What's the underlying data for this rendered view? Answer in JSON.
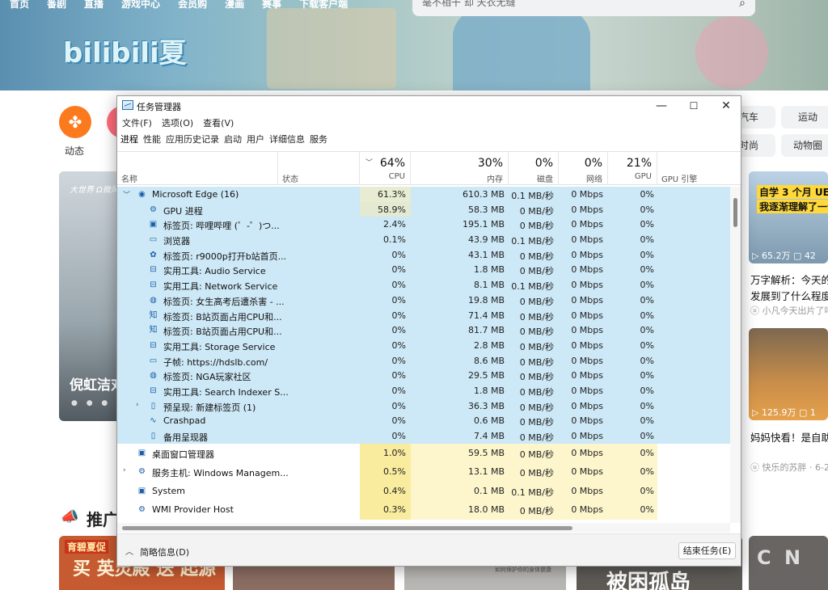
{
  "page": {
    "nav": [
      "首页",
      "番剧",
      "直播",
      "游戏中心",
      "会员购",
      "漫画",
      "赛事",
      "下载客户端"
    ],
    "search_placeholder": "毫不相干 却 天衣无缝",
    "logo_text": "bilibili夏",
    "channel_dongtai": "动态",
    "right_tags": [
      "汽车",
      "运动",
      "时尚",
      "动物圈"
    ],
    "hero_label": "倪虹洁对",
    "hero_mark": "大世界 Ω微风机",
    "hero_dots": "● ● ● ●",
    "video1": {
      "banner1": "自学 3 个月 UE5",
      "banner2": "我逐渐理解了一个",
      "views": "65.2万",
      "extra": "42",
      "title1": "万字解析：今天的",
      "title2": "发展到了什么程度",
      "up": "小凡今天出片了吗"
    },
    "video2": {
      "views": "125.9万",
      "extra": "1",
      "title": "妈妈快看！是自助",
      "up": "快乐的苏胖 · 6-2"
    },
    "recommend_label": "推广",
    "rec1_badge": "育碧夏促",
    "rec1_big": "买 英灵殿 送 起源",
    "rec3_caption": "如何保护你的身体健康",
    "rec4_big": "被困孤岛",
    "rec5_big": "C N"
  },
  "taskmgr": {
    "title": "任务管理器",
    "menu": [
      "文件(F)",
      "选项(O)",
      "查看(V)"
    ],
    "tabs": [
      "进程",
      "性能",
      "应用历史记录",
      "启动",
      "用户",
      "详细信息",
      "服务"
    ],
    "header": {
      "name": "名称",
      "status": "状态",
      "gpu_engine": "GPU 引擎",
      "cpu": {
        "pct": "64%",
        "label": "CPU"
      },
      "mem": {
        "pct": "30%",
        "label": "内存"
      },
      "disk": {
        "pct": "0%",
        "label": "磁盘"
      },
      "net": {
        "pct": "0%",
        "label": "网络"
      },
      "gpu": {
        "pct": "21%",
        "label": "GPU"
      }
    },
    "rows": [
      {
        "exp": "﹀",
        "icon": "edge-icon",
        "glyph": "◉",
        "indent": 0,
        "name": "Microsoft Edge (16)",
        "cpu": "61.3%",
        "mem": "610.3 MB",
        "disk": "0.1 MB/秒",
        "net": "0 Mbps",
        "gpu": "0%",
        "sel": true
      },
      {
        "exp": "",
        "icon": "gpu-process-icon",
        "glyph": "⚙",
        "indent": 1,
        "name": "GPU 进程",
        "cpu": "58.9%",
        "mem": "58.3 MB",
        "disk": "0 MB/秒",
        "net": "0 Mbps",
        "gpu": "0%",
        "sel": true
      },
      {
        "exp": "",
        "icon": "bilibili-tab-icon",
        "glyph": "▣",
        "indent": 1,
        "name": "标签页: 哔哩哔哩 (゜-゜)つ...",
        "cpu": "2.4%",
        "mem": "195.1 MB",
        "disk": "0 MB/秒",
        "net": "0 Mbps",
        "gpu": "0%",
        "sel": true
      },
      {
        "exp": "",
        "icon": "browser-icon",
        "glyph": "▭",
        "indent": 1,
        "name": "浏览器",
        "cpu": "0.1%",
        "mem": "43.9 MB",
        "disk": "0.1 MB/秒",
        "net": "0 Mbps",
        "gpu": "0%",
        "sel": true
      },
      {
        "exp": "",
        "icon": "baidu-tab-icon",
        "glyph": "✿",
        "indent": 1,
        "name": "标签页: r9000p打开b站首页...",
        "cpu": "0%",
        "mem": "43.1 MB",
        "disk": "0 MB/秒",
        "net": "0 Mbps",
        "gpu": "0%",
        "sel": true
      },
      {
        "exp": "",
        "icon": "utility-icon",
        "glyph": "⊟",
        "indent": 1,
        "name": "实用工具: Audio Service",
        "cpu": "0%",
        "mem": "1.8 MB",
        "disk": "0 MB/秒",
        "net": "0 Mbps",
        "gpu": "0%",
        "sel": true
      },
      {
        "exp": "",
        "icon": "utility-icon",
        "glyph": "⊟",
        "indent": 1,
        "name": "实用工具: Network Service",
        "cpu": "0%",
        "mem": "8.1 MB",
        "disk": "0.1 MB/秒",
        "net": "0 Mbps",
        "gpu": "0%",
        "sel": true
      },
      {
        "exp": "",
        "icon": "nga-tab-icon",
        "glyph": "◍",
        "indent": 1,
        "name": "标签页: 女生高考后遭杀害 - ...",
        "cpu": "0%",
        "mem": "19.8 MB",
        "disk": "0 MB/秒",
        "net": "0 Mbps",
        "gpu": "0%",
        "sel": true
      },
      {
        "exp": "",
        "icon": "zhihu-tab-icon",
        "glyph": "知",
        "indent": 1,
        "name": "标签页: B站页面占用CPU和...",
        "cpu": "0%",
        "mem": "71.4 MB",
        "disk": "0 MB/秒",
        "net": "0 Mbps",
        "gpu": "0%",
        "sel": true
      },
      {
        "exp": "",
        "icon": "zhihu-tab-icon",
        "glyph": "知",
        "indent": 1,
        "name": "标签页: B站页面占用CPU和...",
        "cpu": "0%",
        "mem": "81.7 MB",
        "disk": "0 MB/秒",
        "net": "0 Mbps",
        "gpu": "0%",
        "sel": true
      },
      {
        "exp": "",
        "icon": "utility-icon",
        "glyph": "⊟",
        "indent": 1,
        "name": "实用工具: Storage Service",
        "cpu": "0%",
        "mem": "2.8 MB",
        "disk": "0 MB/秒",
        "net": "0 Mbps",
        "gpu": "0%",
        "sel": true
      },
      {
        "exp": "",
        "icon": "subframe-icon",
        "glyph": "▭",
        "indent": 1,
        "name": "子帧: https://hdslb.com/",
        "cpu": "0%",
        "mem": "8.6 MB",
        "disk": "0 MB/秒",
        "net": "0 Mbps",
        "gpu": "0%",
        "sel": true
      },
      {
        "exp": "",
        "icon": "nga-tab-icon",
        "glyph": "◍",
        "indent": 1,
        "name": "标签页: NGA玩家社区",
        "cpu": "0%",
        "mem": "29.5 MB",
        "disk": "0 MB/秒",
        "net": "0 Mbps",
        "gpu": "0%",
        "sel": true
      },
      {
        "exp": "",
        "icon": "utility-icon",
        "glyph": "⊟",
        "indent": 1,
        "name": "实用工具: Search Indexer S...",
        "cpu": "0%",
        "mem": "1.8 MB",
        "disk": "0 MB/秒",
        "net": "0 Mbps",
        "gpu": "0%",
        "sel": true
      },
      {
        "exp": "›",
        "icon": "page-icon",
        "glyph": "▯",
        "indent": 1,
        "name": "预呈现: 新建标签页 (1)",
        "cpu": "0%",
        "mem": "36.3 MB",
        "disk": "0 MB/秒",
        "net": "0 Mbps",
        "gpu": "0%",
        "sel": true
      },
      {
        "exp": "",
        "icon": "crashpad-icon",
        "glyph": "∿",
        "indent": 1,
        "name": "Crashpad",
        "cpu": "0%",
        "mem": "0.6 MB",
        "disk": "0 MB/秒",
        "net": "0 Mbps",
        "gpu": "0%",
        "sel": true
      },
      {
        "exp": "",
        "icon": "page-icon",
        "glyph": "▯",
        "indent": 1,
        "name": "备用呈现器",
        "cpu": "0%",
        "mem": "7.4 MB",
        "disk": "0 MB/秒",
        "net": "0 Mbps",
        "gpu": "0%",
        "sel": true
      },
      {
        "exp": "",
        "icon": "window-icon",
        "glyph": "▣",
        "indent": 0,
        "name": "桌面窗口管理器",
        "cpu": "1.0%",
        "mem": "59.5 MB",
        "disk": "0 MB/秒",
        "net": "0 Mbps",
        "gpu": "0%",
        "sel": false
      },
      {
        "exp": "›",
        "icon": "service-host-icon",
        "glyph": "⚙",
        "indent": 0,
        "name": "服务主机: Windows Managem...",
        "cpu": "0.5%",
        "mem": "13.1 MB",
        "disk": "0 MB/秒",
        "net": "0 Mbps",
        "gpu": "0%",
        "sel": false
      },
      {
        "exp": "",
        "icon": "system-icon",
        "glyph": "▣",
        "indent": 0,
        "name": "System",
        "cpu": "0.4%",
        "mem": "0.1 MB",
        "disk": "0.1 MB/秒",
        "net": "0 Mbps",
        "gpu": "0%",
        "sel": false
      },
      {
        "exp": "",
        "icon": "wmi-icon",
        "glyph": "⚙",
        "indent": 0,
        "name": "WMI Provider Host",
        "cpu": "0.3%",
        "mem": "18.0 MB",
        "disk": "0 MB/秒",
        "net": "0 Mbps",
        "gpu": "0%",
        "sel": false
      }
    ],
    "footer": {
      "fewer_details": "简略信息(D)",
      "end_task": "结束任务(E)"
    },
    "colors": {
      "selected": "#cde8f6",
      "heat_high": "#f9ec9f",
      "heat_low": "#fdf6cd"
    }
  }
}
